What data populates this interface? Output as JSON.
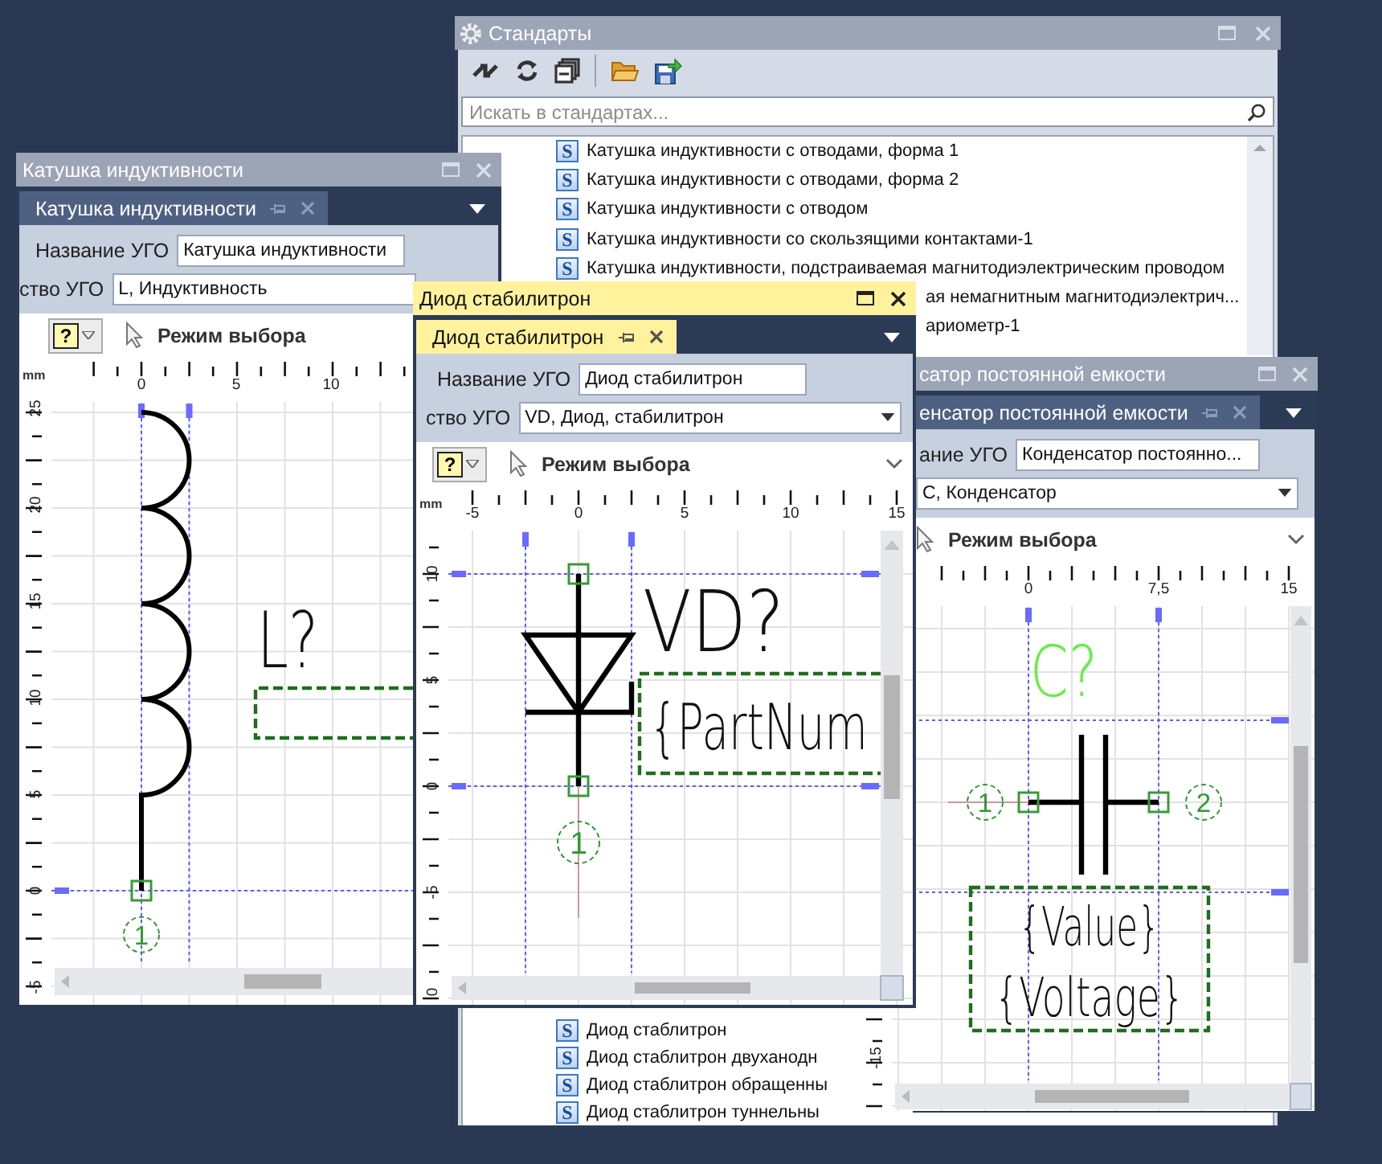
{
  "standards": {
    "title": "Стандарты",
    "search": {
      "placeholder": "Искать в стандартах..."
    },
    "items": [
      {
        "kind": "full",
        "badge": "S",
        "label": "Катушка индуктивности с отводами, форма 1"
      },
      {
        "kind": "full",
        "badge": "S",
        "label": "Катушка индуктивности с отводами, форма 2"
      },
      {
        "kind": "full",
        "badge": "S",
        "label": "Катушка индуктивности с отводом"
      },
      {
        "kind": "full",
        "badge": "S",
        "label": "Катушка индуктивности со скользящими контактами-1"
      },
      {
        "kind": "full",
        "badge": "S",
        "label": "Катушка индуктивности, подстраиваемая магнитодиэлектрическим проводом"
      },
      {
        "kind": "covered",
        "label": "ая немагнитным магнитодиэлектрич..."
      },
      {
        "kind": "covered",
        "label": "ариометр-1"
      }
    ],
    "items_lower": [
      {
        "kind": "full",
        "badge": "S",
        "label": "Диод стаблитрон"
      },
      {
        "kind": "full",
        "badge": "S",
        "label": "Диод стаблитрон двуханодн"
      },
      {
        "kind": "full",
        "badge": "S",
        "label": "Диод стаблитрон обращенны"
      },
      {
        "kind": "full",
        "badge": "S",
        "label": "Диод стаблитрон туннельны"
      }
    ]
  },
  "windows": [
    {
      "kind": "inductor",
      "active": false,
      "title": "Катушка индуктивности",
      "tab": "Катушка индуктивности",
      "name_label": "Название УГО",
      "name_value": "Катушка индуктивности",
      "designation_label": "ство УГО",
      "designation_value": "L, Индуктивность",
      "help_button": "?",
      "mode": "Режим выбора",
      "canvas": {
        "unit": "mm",
        "x_ruler": [
          "0",
          "5",
          "10"
        ],
        "y_ruler": [
          "25",
          "20",
          "15",
          "10",
          "5",
          "0",
          "-5"
        ],
        "refdes": "L?",
        "refdes_highlighted": false,
        "pins": [
          "1"
        ]
      }
    },
    {
      "kind": "cap",
      "active": false,
      "title": "сатор постоянной емкости",
      "tab": "енсатор постоянной емкости",
      "name_label": "ание УГО",
      "name_value": "Конденсатор постоянно...",
      "designation_value": "C, Конденсатор",
      "mode": "Режим выбора",
      "canvas": {
        "x_ruler": [
          "0",
          "7,5",
          "15"
        ],
        "y_ruler": [
          "-15"
        ],
        "refdes": "C?",
        "refdes_highlighted": true,
        "pins": [
          "1",
          "2"
        ],
        "fields": [
          "{Value}",
          "{Voltage}"
        ]
      }
    },
    {
      "kind": "diode",
      "active": true,
      "title": "Диод стабилитрон",
      "tab": "Диод стабилитрон",
      "name_label": "Название УГО",
      "name_value": "Диод стабилитрон",
      "designation_label": "ство УГО",
      "designation_value": "VD, Диод, стабилитрон",
      "help_button": "?",
      "mode": "Режим выбора",
      "canvas": {
        "unit": "mm",
        "x_ruler": [
          "-5",
          "0",
          "5",
          "10",
          "15"
        ],
        "y_ruler": [
          "10",
          "5",
          "0",
          "-5",
          "0"
        ],
        "refdes": "VD?",
        "refdes_highlighted": false,
        "pins": [
          "1"
        ],
        "fields": [
          "{PartNum"
        ]
      }
    }
  ]
}
